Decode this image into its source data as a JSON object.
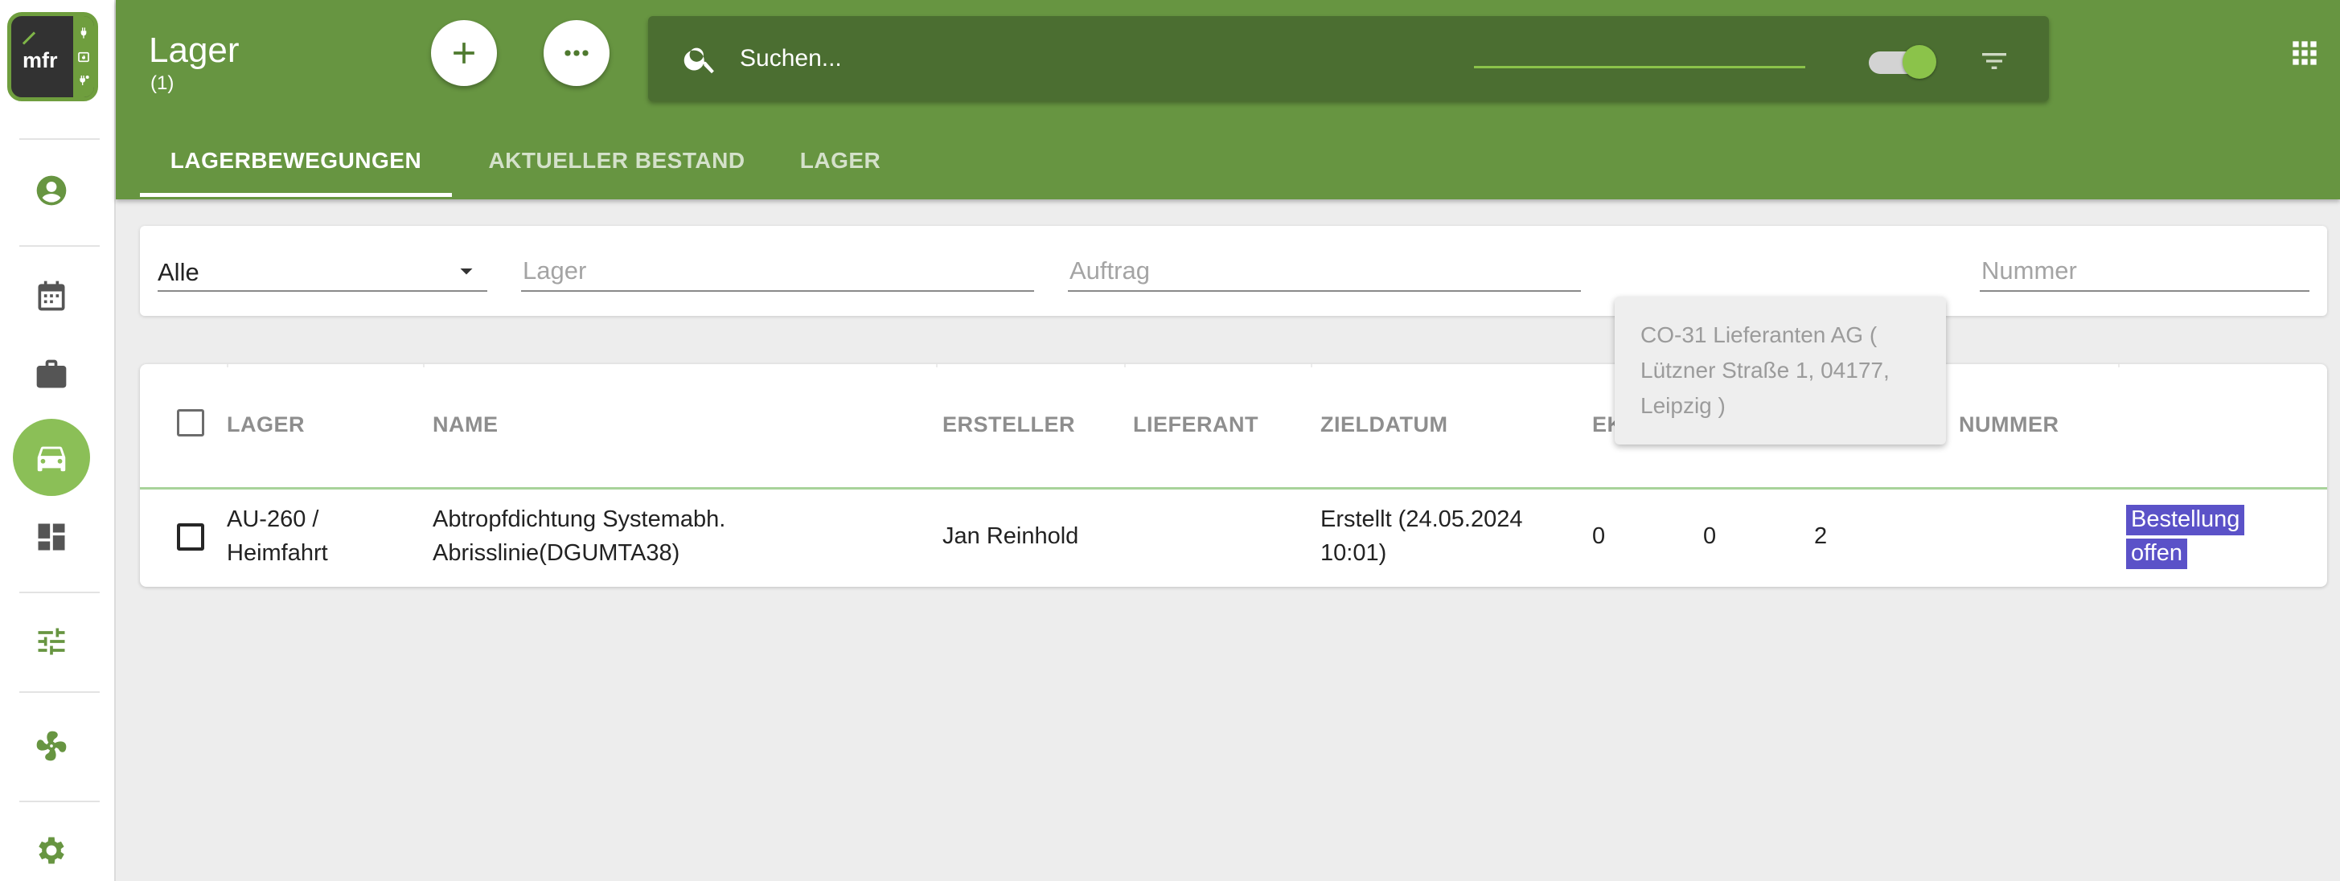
{
  "app": {
    "logo_text": "mfr",
    "colors": {
      "appbar": "#679541",
      "search_bg": "#4b6e31",
      "accent": "#8bc34a",
      "rail_active": "#8bbf57",
      "status_badge": "#5b52c8"
    }
  },
  "sidebar": {
    "items": [
      {
        "icon": "account-circle-icon",
        "active": false
      },
      {
        "icon": "calendar-icon",
        "active": false
      },
      {
        "icon": "briefcase-icon",
        "active": false
      },
      {
        "icon": "car-icon",
        "active": true
      },
      {
        "icon": "dashboard-icon",
        "active": false
      },
      {
        "icon": "tune-icon",
        "active": false
      },
      {
        "icon": "fan-icon",
        "active": false
      },
      {
        "icon": "gear-icon",
        "active": false
      }
    ]
  },
  "header": {
    "title": "Lager",
    "count": "(1)",
    "add_icon": "plus-icon",
    "more_icon": "more-horizontal-icon"
  },
  "search": {
    "placeholder": "Suchen...",
    "toggle_on": true
  },
  "tabs": [
    {
      "label": "LAGERBEWEGUNGEN",
      "active": true
    },
    {
      "label": "AKTUELLER BESTAND",
      "active": false
    },
    {
      "label": "LAGER",
      "active": false
    }
  ],
  "filters": {
    "type_select": {
      "value": "Alle"
    },
    "lager": {
      "placeholder": "Lager",
      "value": ""
    },
    "auftrag": {
      "placeholder": "Auftrag",
      "value": ""
    },
    "lieferant": {
      "placeholder": "",
      "value": ""
    },
    "nummer": {
      "placeholder": "Nummer",
      "value": ""
    }
  },
  "autocomplete": {
    "suggestion": "CO-31 Lieferanten AG ( Lützner Straße 1, 04177, Leipzig )"
  },
  "table": {
    "headers": {
      "lager": "LAGER",
      "name": "NAME",
      "ersteller": "ERSTELLER",
      "lieferant": "LIEFERANT",
      "zieldatum": "ZIELDATUM",
      "ek": "EK",
      "nummer": "NUMMER"
    },
    "rows": [
      {
        "lager": "AU-260 / Heimfahrt",
        "name": "Abtropfdichtung Systemabh. Abrisslinie(DGUMTA38)",
        "ersteller": "Jan Reinhold",
        "lieferant": "",
        "zieldatum": "Erstellt (24.05.2024 10:01)",
        "ek": "0",
        "col_b": "0",
        "col_c": "2",
        "nummer": "",
        "status": "Bestellung offen"
      }
    ]
  }
}
